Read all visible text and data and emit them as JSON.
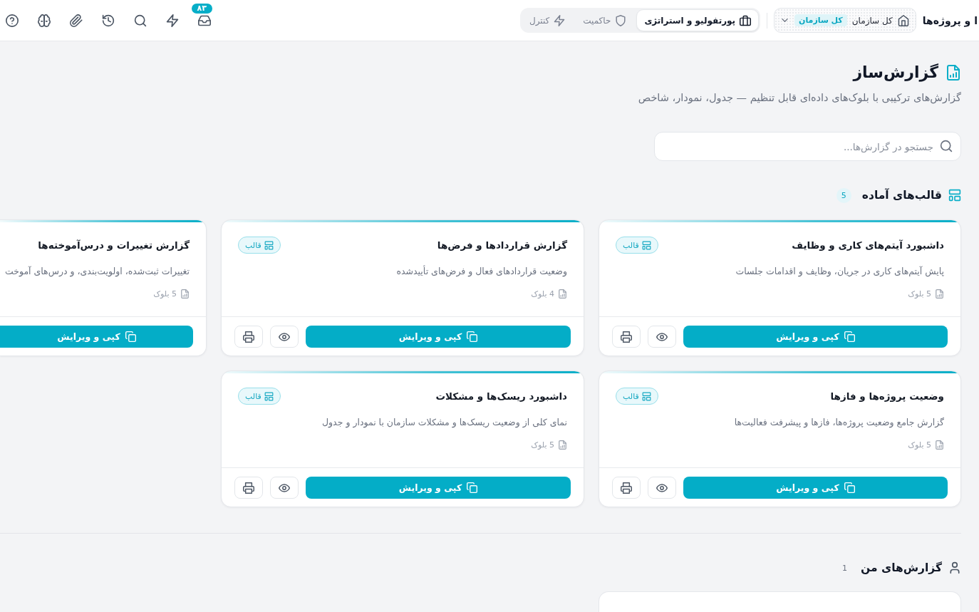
{
  "topbar": {
    "title": "ا و پروژه‌ها",
    "scope": {
      "label": "کل سازمان",
      "tag": "کل سازمان"
    },
    "tabs": [
      {
        "label": "پورتفولیو و استراتژی",
        "selected": true
      },
      {
        "label": "حاکمیت",
        "selected": false
      },
      {
        "label": "کنترل",
        "selected": false
      }
    ],
    "inbox_count": "۸۳"
  },
  "header": {
    "title": "گزارش‌ساز",
    "subtitle": "گزارش‌های ترکیبی با بلوک‌های داده‌ای قابل تنظیم — جدول، نمودار، شاخص"
  },
  "search": {
    "placeholder": "جستجو در گزارش‌ها..."
  },
  "templates": {
    "title": "قالب‌های آماده",
    "count": "5",
    "cards": [
      {
        "title": "داشبورد آیتم‌های کاری و وظایف",
        "badge": "قالب",
        "description": "پایش آیتم‌های کاری در جریان، وظایف و اقدامات جلسات",
        "blocks": "5 بلوک",
        "action": "کپی و ویرایش",
        "tools": [
          {
            "kind": "preview"
          },
          {
            "kind": "print"
          }
        ]
      },
      {
        "title": "گزارش قراردادها و فرض‌ها",
        "badge": "قالب",
        "description": "وضعیت قراردادهای فعال و فرض‌های تأییدشده",
        "blocks": "4 بلوک",
        "action": "کپی و ویرایش",
        "tools": [
          {
            "kind": "preview"
          },
          {
            "kind": "print"
          }
        ]
      },
      {
        "title": "گزارش تغییرات و درس‌آموخته‌ها",
        "description": "تغییرات ثبت‌شده، اولویت‌بندی، و درس‌های آموخت",
        "blocks": "5 بلوک",
        "action": "کپی و ویرایش"
      },
      {
        "title": "وضعیت پروژه‌ها و فازها",
        "badge": "قالب",
        "description": "گزارش جامع وضعیت پروژه‌ها، فازها و پیشرفت فعالیت‌ها",
        "blocks": "5 بلوک",
        "action": "کپی و ویرایش",
        "tools": [
          {
            "kind": "preview"
          },
          {
            "kind": "print"
          }
        ]
      },
      {
        "title": "داشبورد ریسک‌ها و مشکلات",
        "badge": "قالب",
        "description": "نمای کلی از وضعیت ریسک‌ها و مشکلات سازمان با نمودار و جدول",
        "blocks": "5 بلوک",
        "action": "کپی و ویرایش",
        "tools": [
          {
            "kind": "preview"
          },
          {
            "kind": "print"
          }
        ]
      }
    ]
  },
  "my_reports": {
    "title": "گزارش‌های من",
    "count": "1"
  }
}
